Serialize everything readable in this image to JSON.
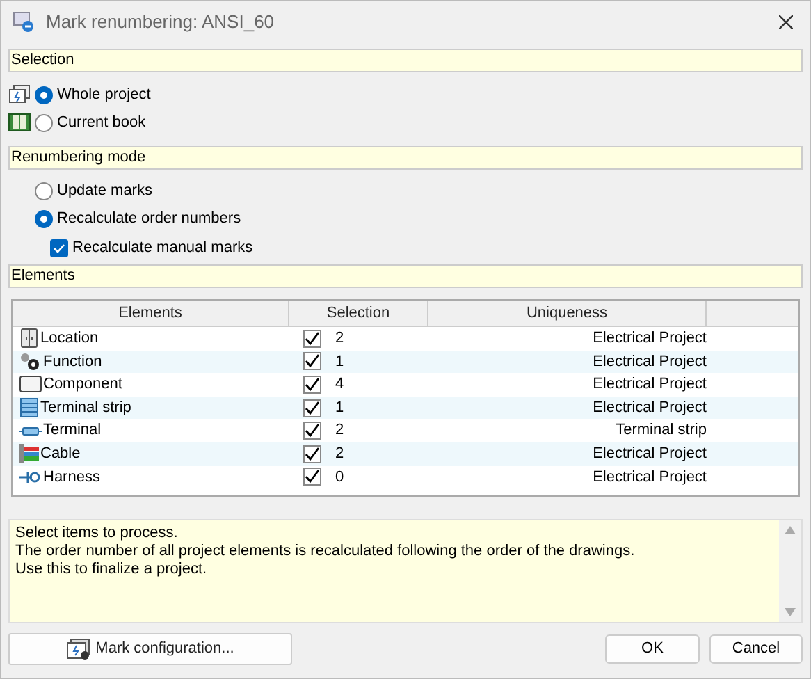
{
  "window": {
    "title": "Mark renumbering: ANSI_60"
  },
  "selection": {
    "header": "Selection",
    "options": [
      {
        "label": "Whole project",
        "selected": true
      },
      {
        "label": "Current book",
        "selected": false
      }
    ]
  },
  "renumbering_mode": {
    "header": "Renumbering mode",
    "options": [
      {
        "label": "Update marks",
        "selected": false
      },
      {
        "label": "Recalculate order numbers",
        "selected": true
      }
    ],
    "recalculate_manual_marks": {
      "label": "Recalculate manual marks",
      "checked": true
    }
  },
  "elements": {
    "header": "Elements",
    "table": {
      "columns": [
        "Elements",
        "Selection",
        "Uniqueness"
      ],
      "rows": [
        {
          "element": "Location",
          "checked": true,
          "selection": "2",
          "uniqueness": "Electrical Project"
        },
        {
          "element": "Function",
          "checked": true,
          "selection": "1",
          "uniqueness": "Electrical Project"
        },
        {
          "element": "Component",
          "checked": true,
          "selection": "4",
          "uniqueness": "Electrical Project"
        },
        {
          "element": "Terminal strip",
          "checked": true,
          "selection": "1",
          "uniqueness": "Electrical Project"
        },
        {
          "element": "Terminal",
          "checked": true,
          "selection": "2",
          "uniqueness": "Terminal strip"
        },
        {
          "element": "Cable",
          "checked": true,
          "selection": "2",
          "uniqueness": "Electrical Project"
        },
        {
          "element": "Harness",
          "checked": true,
          "selection": "0",
          "uniqueness": "Electrical Project"
        }
      ]
    }
  },
  "info": [
    "Select items to process.",
    "The order number of all project elements is recalculated following the order of the drawings.",
    "Use this to finalize a project."
  ],
  "buttons": {
    "mark_configuration": "Mark configuration...",
    "ok": "OK",
    "cancel": "Cancel"
  }
}
